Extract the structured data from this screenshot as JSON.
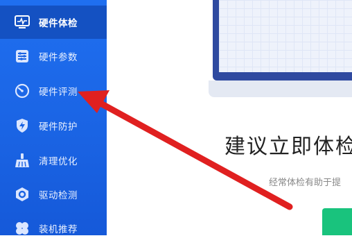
{
  "sidebar": {
    "items": [
      {
        "label": "硬件体检",
        "icon": "monitor-pulse-icon",
        "active": true
      },
      {
        "label": "硬件参数",
        "icon": "sliders-icon",
        "active": false
      },
      {
        "label": "硬件评测",
        "icon": "speedometer-icon",
        "active": false
      },
      {
        "label": "硬件防护",
        "icon": "shield-bolt-icon",
        "active": false
      },
      {
        "label": "清理优化",
        "icon": "broom-icon",
        "active": false
      },
      {
        "label": "驱动检测",
        "icon": "hexagon-gear-icon",
        "active": false
      },
      {
        "label": "装机推荐",
        "icon": "clover-icon",
        "active": false
      }
    ]
  },
  "main": {
    "headline": "建议立即体检",
    "subline": "经常体检有助于提"
  },
  "colors": {
    "sidebar": "#1a63e3",
    "active_item": "#1451c2",
    "arrow": "#e02020",
    "start_button": "#19c37d"
  }
}
